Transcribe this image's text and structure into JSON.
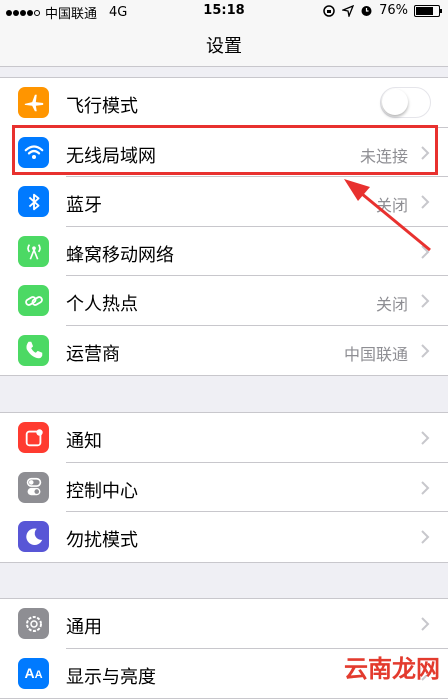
{
  "status_bar": {
    "carrier": "中国联通",
    "network": "4G",
    "time": "15:18",
    "battery": "76%",
    "battery_level_percent": 76
  },
  "nav": {
    "title": "设置"
  },
  "group1": [
    {
      "label": "飞行模式",
      "icon": "airplane-icon",
      "color": "#ff9500",
      "control": "toggle",
      "toggle_on": false
    },
    {
      "label": "无线局域网",
      "value": "未连接",
      "icon": "wifi-icon",
      "color": "#007aff"
    },
    {
      "label": "蓝牙",
      "value": "关闭",
      "icon": "bluetooth-icon",
      "color": "#007aff"
    },
    {
      "label": "蜂窝移动网络",
      "value": "",
      "icon": "cellular-antenna-icon",
      "color": "#4cd964"
    },
    {
      "label": "个人热点",
      "value": "关闭",
      "icon": "hotspot-link-icon",
      "color": "#4cd964"
    },
    {
      "label": "运营商",
      "value": "中国联通",
      "icon": "phone-icon",
      "color": "#4cd964"
    }
  ],
  "group2": [
    {
      "label": "通知",
      "icon": "notification-icon",
      "color": "#ff3b30"
    },
    {
      "label": "控制中心",
      "icon": "control-center-icon",
      "color": "#8e8e93"
    },
    {
      "label": "勿扰模式",
      "icon": "moon-icon",
      "color": "#5856d6"
    }
  ],
  "group3": [
    {
      "label": "通用",
      "icon": "gear-icon",
      "color": "#8e8e93"
    },
    {
      "label": "显示与亮度",
      "icon": "text-size-icon",
      "color": "#007aff"
    }
  ],
  "annotation": {
    "highlight_color": "#e8312f"
  },
  "watermark": "云南龙网"
}
